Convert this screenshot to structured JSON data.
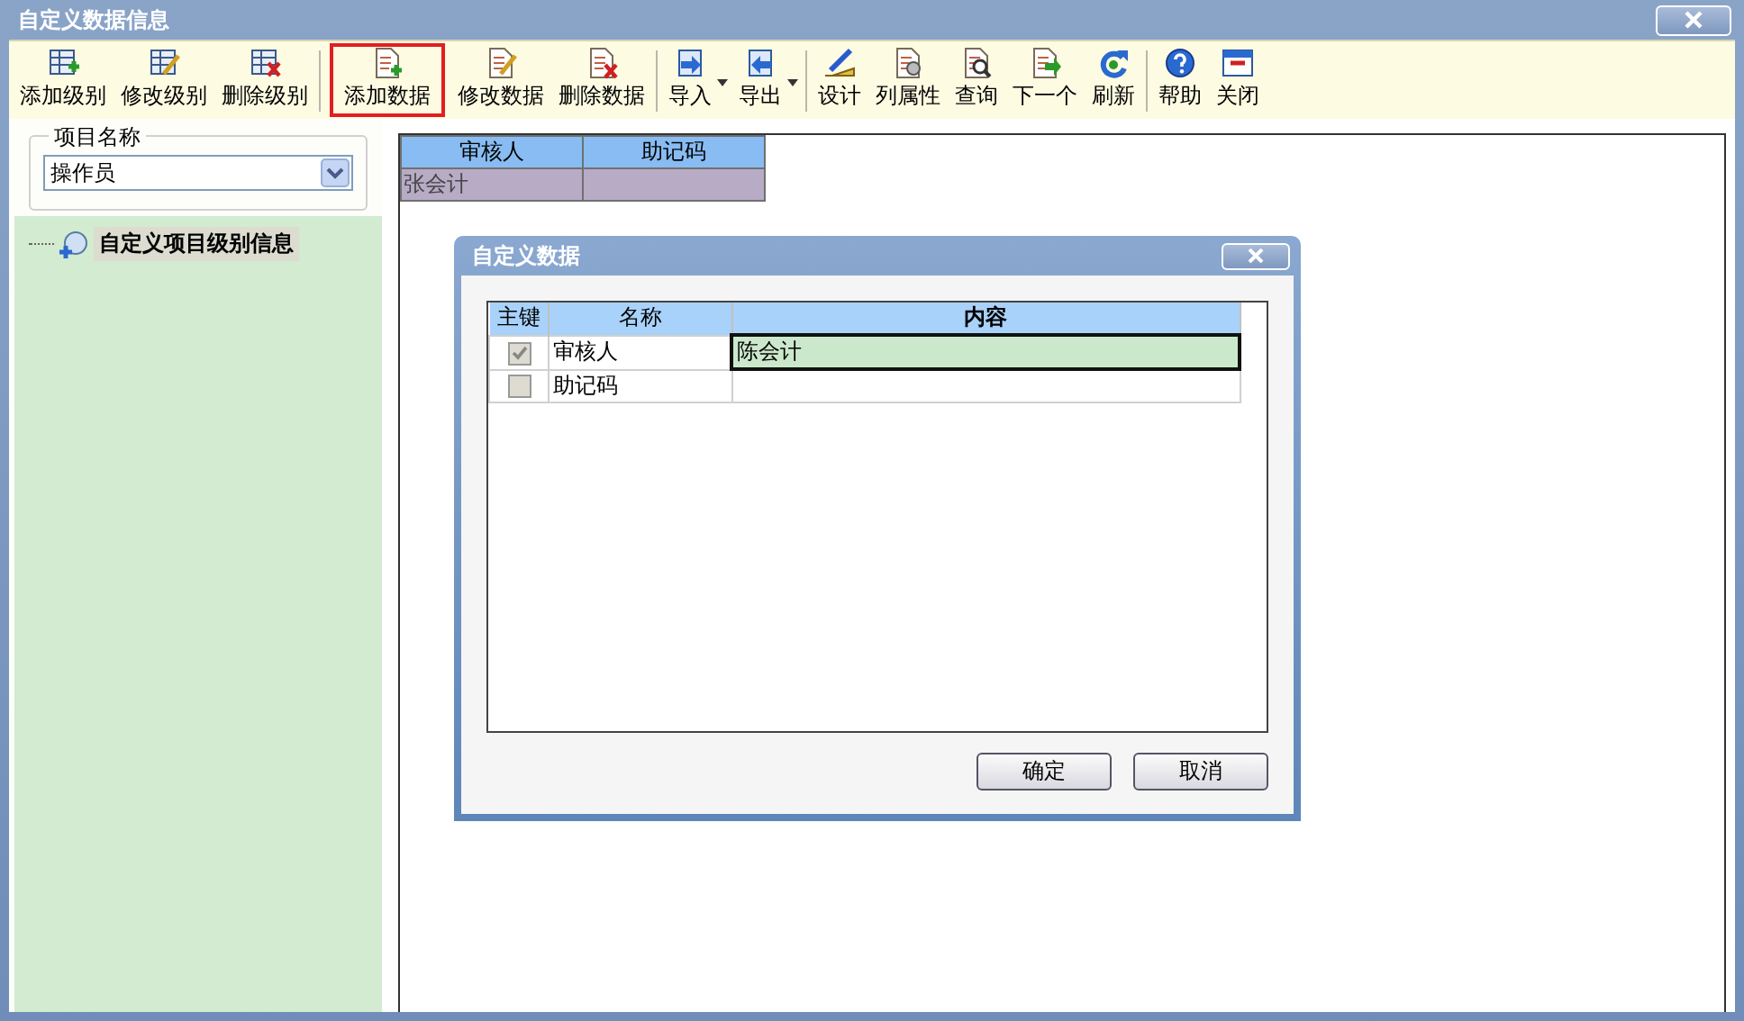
{
  "window": {
    "title": "自定义数据信息"
  },
  "toolbar": {
    "groups": [
      {
        "items": [
          {
            "label": "添加级别",
            "selected": false,
            "dropdown": false
          },
          {
            "label": "修改级别",
            "selected": false,
            "dropdown": false
          },
          {
            "label": "删除级别",
            "selected": false,
            "dropdown": false
          }
        ]
      },
      {
        "items": [
          {
            "label": "添加数据",
            "selected": true,
            "dropdown": false
          },
          {
            "label": "修改数据",
            "selected": false,
            "dropdown": false
          },
          {
            "label": "删除数据",
            "selected": false,
            "dropdown": false
          }
        ]
      },
      {
        "items": [
          {
            "label": "导入",
            "selected": false,
            "dropdown": true
          },
          {
            "label": "导出",
            "selected": false,
            "dropdown": true
          }
        ]
      },
      {
        "items": [
          {
            "label": "设计",
            "selected": false,
            "dropdown": false
          },
          {
            "label": "列属性",
            "selected": false,
            "dropdown": false
          },
          {
            "label": "查询",
            "selected": false,
            "dropdown": false
          },
          {
            "label": "下一个",
            "selected": false,
            "dropdown": false
          },
          {
            "label": "刷新",
            "selected": false,
            "dropdown": false
          }
        ]
      },
      {
        "items": [
          {
            "label": "帮助",
            "selected": false,
            "dropdown": false
          },
          {
            "label": "关闭",
            "selected": false,
            "dropdown": false
          }
        ]
      }
    ]
  },
  "sidebar": {
    "group_label": "项目名称",
    "select_value": "操作员",
    "tree": [
      {
        "label": "自定义项目级别信息",
        "selected": true
      }
    ]
  },
  "table": {
    "columns": [
      "审核人",
      "助记码"
    ],
    "rows": [
      {
        "cells": [
          "张会计"
        ]
      }
    ]
  },
  "dialog": {
    "title": "自定义数据",
    "columns": [
      "主键",
      "名称",
      "内容"
    ],
    "rows": [
      {
        "checked": true,
        "name": "审核人",
        "value": "陈会计",
        "selected": true
      },
      {
        "checked": false,
        "name": "助记码",
        "selected": false
      }
    ],
    "buttons": [
      "确定",
      "取消"
    ]
  }
}
